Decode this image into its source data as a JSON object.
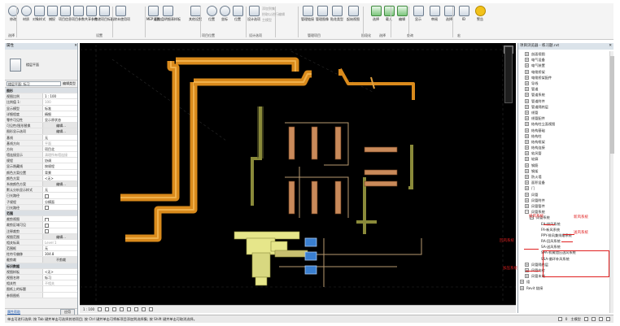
{
  "ribbon": {
    "buttons": [
      {
        "label": "修改",
        "icon": "modify-cursor-icon"
      },
      {
        "label": "材质",
        "icon": "material-icon"
      },
      {
        "label": "对象样式",
        "icon": "object-style-icon"
      },
      {
        "label": "捕捉",
        "icon": "snap-icon"
      },
      {
        "label": "项目信息",
        "icon": "project-info-icon"
      },
      {
        "label": "项目参数",
        "icon": "project-params-icon"
      },
      {
        "label": "共享参数",
        "icon": "shared-params-icon"
      },
      {
        "label": "传递项目标准",
        "icon": "transfer-standards-icon"
      },
      {
        "label": "清除未使用项",
        "icon": "purge-icon"
      },
      {
        "label": "MEP设置",
        "icon": "mep-settings-icon"
      },
      {
        "label": "配电盘明细表样板",
        "icon": "panel-schedule-icon"
      },
      {
        "label": "其他设置",
        "icon": "wrench-icon"
      },
      {
        "label": "位置",
        "icon": "location-icon"
      },
      {
        "label": "坐标",
        "icon": "coordinates-icon"
      },
      {
        "label": "位置",
        "icon": "position-icon"
      },
      {
        "label": "设计选项",
        "icon": "design-options-icon"
      },
      {
        "label": "管理链接",
        "icon": "manage-links-icon"
      },
      {
        "label": "管理图像",
        "icon": "manage-images-icon"
      },
      {
        "label": "贴花类型",
        "icon": "decal-types-icon"
      },
      {
        "label": "起始视图",
        "icon": "starting-view-icon"
      },
      {
        "label": "选择",
        "icon": "select-icon"
      },
      {
        "label": "载入",
        "icon": "load-icon"
      },
      {
        "label": "编辑",
        "icon": "edit-icon"
      },
      {
        "label": "显示",
        "icon": "show-icon"
      },
      {
        "label": "审阅",
        "icon": "review-icon"
      },
      {
        "label": "选择",
        "icon": "select2-icon"
      },
      {
        "label": "ID",
        "icon": "id-icon"
      },
      {
        "label": "警告",
        "icon": "warning-icon"
      }
    ],
    "groups": [
      "选择",
      "设置",
      "项目位置",
      "设计选项",
      "管理项目",
      "阶段化",
      "选择",
      "查询",
      "宏"
    ],
    "disabled_items": [
      "添加到集",
      "拾取以进行编辑",
      "主模型"
    ]
  },
  "properties": {
    "title": "属性",
    "type_name": "楼层平面",
    "filter_label": "楼层平面: 标习",
    "edit_type": "编辑类型",
    "rows": [
      {
        "k": "图形",
        "v": "",
        "hdr": true
      },
      {
        "k": "视图比例",
        "v": "1 : 100"
      },
      {
        "k": "比例值 1:",
        "v": "100",
        "grey": true
      },
      {
        "k": "显示模型",
        "v": "标准"
      },
      {
        "k": "详细程度",
        "v": "精细"
      },
      {
        "k": "零件可见性",
        "v": "显示原状态"
      },
      {
        "k": "可见性/图形替换",
        "v": "编辑...",
        "btn": true
      },
      {
        "k": "图形显示选项",
        "v": "编辑...",
        "btn": true
      },
      {
        "k": "基线",
        "v": "无"
      },
      {
        "k": "基线方向",
        "v": "平面",
        "grey": true
      },
      {
        "k": "方向",
        "v": "项目北"
      },
      {
        "k": "墙连接显示",
        "v": "清理所有墙连接",
        "grey": true
      },
      {
        "k": "规程",
        "v": "协调"
      },
      {
        "k": "显示隐藏线",
        "v": "按规程"
      },
      {
        "k": "颜色方案位置",
        "v": "背景"
      },
      {
        "k": "颜色方案",
        "v": "<无>"
      },
      {
        "k": "系统颜色方案",
        "v": "编辑...",
        "btn": true
      },
      {
        "k": "默认分析显示样式",
        "v": "无"
      },
      {
        "k": "日光路径",
        "v": "",
        "cb": true
      },
      {
        "k": "子规程",
        "v": "分模面"
      },
      {
        "k": "日光路径",
        "v": "",
        "cb": true
      },
      {
        "k": "范围",
        "v": "",
        "hdr": true
      },
      {
        "k": "裁剪视图",
        "v": "",
        "cb": true
      },
      {
        "k": "裁剪区域可见",
        "v": "",
        "cb": true
      },
      {
        "k": "注释裁剪",
        "v": "",
        "cb": true
      },
      {
        "k": "视图范围",
        "v": "编辑...",
        "btn": true
      },
      {
        "k": "相关标高",
        "v": "Level 1",
        "grey": true
      },
      {
        "k": "范围框",
        "v": "无"
      },
      {
        "k": "柱符号偏移",
        "v": "304.8"
      },
      {
        "k": "截剪裁",
        "v": "不剪裁",
        "btn": true
      },
      {
        "k": "标识数据",
        "v": "",
        "hdr": true
      },
      {
        "k": "视图样板",
        "v": "<无>"
      },
      {
        "k": "视图名称",
        "v": "标习"
      },
      {
        "k": "相关性",
        "v": "不相关",
        "grey": true
      },
      {
        "k": "图纸上的标题",
        "v": ""
      },
      {
        "k": "参照图纸",
        "v": "",
        "grey": true
      }
    ],
    "help_link": "属性帮助",
    "apply": "应用"
  },
  "view_bar": {
    "scale": "1 : 100"
  },
  "browser": {
    "title": "项目浏览器 - 练习题.rvt",
    "items": [
      {
        "t": "剖面视图",
        "d": 1,
        "tog": "+"
      },
      {
        "t": "电气设备",
        "d": 1,
        "tog": "+"
      },
      {
        "t": "电气装置",
        "d": 1,
        "tog": "+"
      },
      {
        "t": "电缆桥架",
        "d": 1,
        "tog": "+"
      },
      {
        "t": "电缆桥架配件",
        "d": 1,
        "tog": "+"
      },
      {
        "t": "导线",
        "d": 1,
        "tog": "+"
      },
      {
        "t": "管道",
        "d": 1,
        "tog": "+"
      },
      {
        "t": "管道系统",
        "d": 1,
        "tog": "+"
      },
      {
        "t": "管道附件",
        "d": 1,
        "tog": "+"
      },
      {
        "t": "管道隔热层",
        "d": 1,
        "tog": "+"
      },
      {
        "t": "线管",
        "d": 1,
        "tog": "+"
      },
      {
        "t": "线管配件",
        "d": 1,
        "tog": "+"
      },
      {
        "t": "结构柱立面视图",
        "d": 1,
        "tog": "+"
      },
      {
        "t": "结构基础",
        "d": 1,
        "tog": "+"
      },
      {
        "t": "结构柱",
        "d": 1,
        "tog": "+"
      },
      {
        "t": "结构框架",
        "d": 1,
        "tog": "+"
      },
      {
        "t": "结构连接",
        "d": 1,
        "tog": "+"
      },
      {
        "t": "软风管",
        "d": 1,
        "tog": "+"
      },
      {
        "t": "轮廓",
        "d": 1,
        "tog": "+"
      },
      {
        "t": "钢筋",
        "d": 1,
        "tog": "+"
      },
      {
        "t": "钢架",
        "d": 1,
        "tog": "+"
      },
      {
        "t": "防火墙",
        "d": 1,
        "tog": "+"
      },
      {
        "t": "面积设备",
        "d": 1,
        "tog": "+"
      },
      {
        "t": "门",
        "d": 1,
        "tog": "+"
      },
      {
        "t": "风管",
        "d": 1,
        "tog": "+"
      },
      {
        "t": "风管附件",
        "d": 1,
        "tog": "+"
      },
      {
        "t": "风管管件",
        "d": 1,
        "tog": "+"
      },
      {
        "t": "风管系统",
        "d": 1,
        "tog": "-"
      },
      {
        "t": "风管系统",
        "d": 2,
        "tog": "-"
      },
      {
        "t": "EA-排风系统",
        "d": 3,
        "tog": ""
      },
      {
        "t": "FA-新风系统",
        "d": 3,
        "tog": ""
      },
      {
        "t": "PPY-排风兼排烟系统",
        "d": 3,
        "tog": ""
      },
      {
        "t": "RA-回风系统",
        "d": 3,
        "tog": ""
      },
      {
        "t": "SA-送风系统",
        "d": 3,
        "tog": ""
      },
      {
        "t": "SPA-机械加压送风系统",
        "d": 3,
        "tog": ""
      },
      {
        "t": "SSA-循环补风系统",
        "d": 3,
        "tog": ""
      },
      {
        "t": "风管隔热层",
        "d": 1,
        "tog": "+"
      },
      {
        "t": "风管内衬",
        "d": 1,
        "tog": "+"
      },
      {
        "t": "风管末端",
        "d": 1,
        "tog": "+"
      },
      {
        "t": "组",
        "d": 0,
        "tog": "+"
      },
      {
        "t": "Revit 链接",
        "d": 0,
        "tog": "+"
      }
    ],
    "annotations": [
      {
        "text": "排风系统",
        "name": "annotation-exhaust"
      },
      {
        "text": "新风系统",
        "name": "annotation-fresh-air"
      },
      {
        "text": "回风系统",
        "name": "annotation-return-air"
      },
      {
        "text": "送风系统",
        "name": "annotation-supply-air"
      },
      {
        "text": "加压系统",
        "name": "annotation-pressurize"
      }
    ]
  },
  "status": {
    "text": "单击可进行选择; 按 Tab 键并单击可选择其他项目; 按 Ctrl 键并单击可将新项目添加到选择集; 按 Shift 键并单击可取消选择。",
    "zero": "0",
    "model": "主模型"
  },
  "colors": {
    "canvas_bg": "#000000",
    "duct_orange": "#d98a1c",
    "pipe_copper": "#c98a5a",
    "pipe_olive": "#8a8a3a",
    "equipment_yellow": "#e6e68a",
    "equipment_blue": "#3a7fd0",
    "annotation_red": "#e02020"
  }
}
